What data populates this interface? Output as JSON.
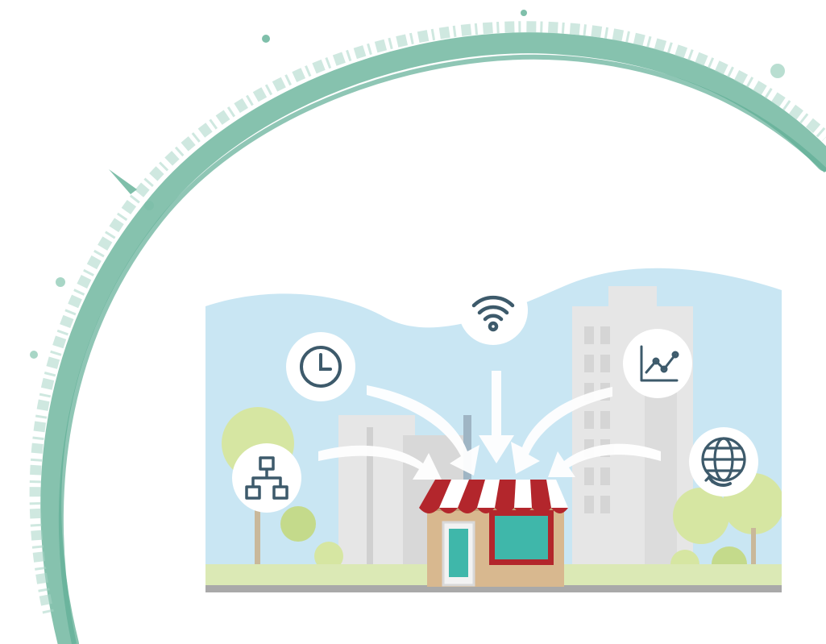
{
  "scene": {
    "description_free": true,
    "colors": {
      "ring": "#7fbfaa",
      "ring_dark": "#5fae96",
      "sky": "#c9e6f3",
      "hills": "#e9f3f8",
      "building_light": "#e6e6e6",
      "building_mid": "#d8d8d8",
      "tree": "#d6e6a2",
      "tree_dark": "#c4da8b",
      "ground": "#a9a9a9",
      "awning_red": "#b3262c",
      "awning_white": "#ffffff",
      "shop_wall": "#d8b88f",
      "shop_window": "#3fb7aa",
      "icon_stroke": "#3d5a6b",
      "icon_bg": "#ffffff",
      "arrow": "#ffffff"
    },
    "icons": [
      "wifi-icon",
      "clock-icon",
      "chart-icon",
      "network-icon",
      "globe-refresh-icon"
    ]
  }
}
